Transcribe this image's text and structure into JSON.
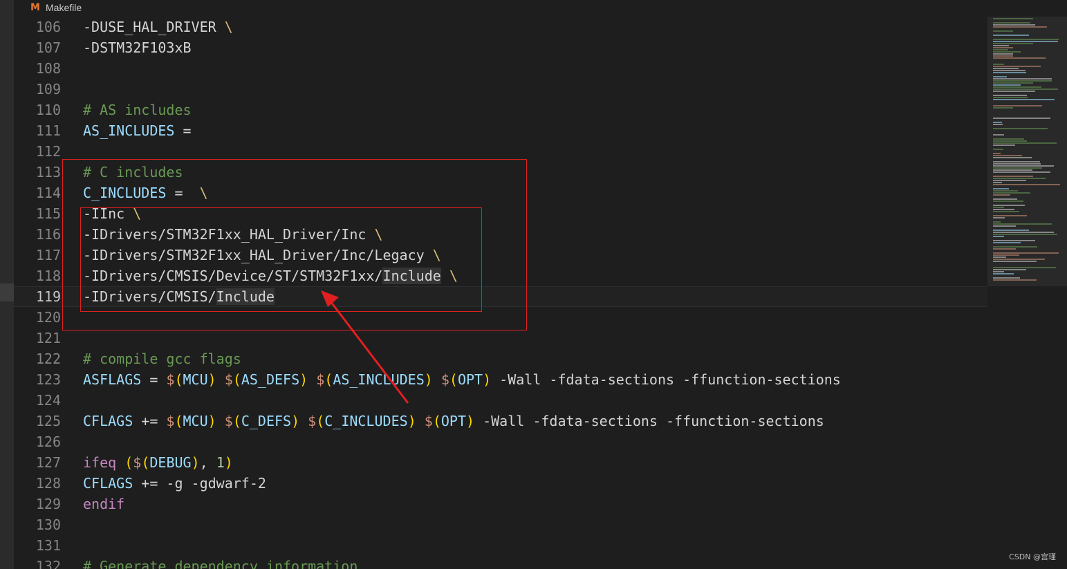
{
  "tab": {
    "label": "Makefile",
    "icon": "makefile-m-icon",
    "icon_glyph": "M"
  },
  "lines": [
    {
      "n": "106",
      "tokens": [
        [
          "plain",
          "-DUSE_HAL_DRIVER "
        ],
        [
          "punct",
          "\\"
        ]
      ]
    },
    {
      "n": "107",
      "tokens": [
        [
          "plain",
          "-DSTM32F103xB"
        ]
      ]
    },
    {
      "n": "108",
      "tokens": []
    },
    {
      "n": "109",
      "tokens": []
    },
    {
      "n": "110",
      "tokens": [
        [
          "comment",
          "# AS includes"
        ]
      ]
    },
    {
      "n": "111",
      "tokens": [
        [
          "var",
          "AS_INCLUDES"
        ],
        [
          "plain",
          " ="
        ]
      ]
    },
    {
      "n": "112",
      "tokens": []
    },
    {
      "n": "113",
      "tokens": [
        [
          "comment",
          "# C includes"
        ]
      ]
    },
    {
      "n": "114",
      "tokens": [
        [
          "var",
          "C_INCLUDES"
        ],
        [
          "plain",
          " =  "
        ],
        [
          "punct",
          "\\"
        ]
      ]
    },
    {
      "n": "115",
      "tokens": [
        [
          "plain",
          "-IInc "
        ],
        [
          "punct",
          "\\"
        ]
      ]
    },
    {
      "n": "116",
      "tokens": [
        [
          "plain",
          "-IDrivers/STM32F1xx_HAL_Driver/Inc "
        ],
        [
          "punct",
          "\\"
        ]
      ]
    },
    {
      "n": "117",
      "tokens": [
        [
          "plain",
          "-IDrivers/STM32F1xx_HAL_Driver/Inc/Legacy "
        ],
        [
          "punct",
          "\\"
        ]
      ]
    },
    {
      "n": "118",
      "tokens": [
        [
          "plain",
          "-IDrivers/CMSIS/Device/ST/STM32F1xx/"
        ],
        [
          "hl",
          "Include"
        ],
        [
          "plain",
          " "
        ],
        [
          "punct",
          "\\"
        ]
      ]
    },
    {
      "n": "119",
      "current": true,
      "tokens": [
        [
          "plain",
          "-IDrivers/CMSIS/"
        ],
        [
          "hl",
          "Include"
        ]
      ]
    },
    {
      "n": "120",
      "tokens": []
    },
    {
      "n": "121",
      "tokens": []
    },
    {
      "n": "122",
      "tokens": [
        [
          "comment",
          "# compile gcc flags"
        ]
      ]
    },
    {
      "n": "123",
      "tokens": [
        [
          "var",
          "ASFLAGS"
        ],
        [
          "plain",
          " = "
        ],
        [
          "dollar",
          "$"
        ],
        [
          "paren",
          "("
        ],
        [
          "var",
          "MCU"
        ],
        [
          "paren",
          ")"
        ],
        [
          "plain",
          " "
        ],
        [
          "dollar",
          "$"
        ],
        [
          "paren",
          "("
        ],
        [
          "var",
          "AS_DEFS"
        ],
        [
          "paren",
          ")"
        ],
        [
          "plain",
          " "
        ],
        [
          "dollar",
          "$"
        ],
        [
          "paren",
          "("
        ],
        [
          "var",
          "AS_INCLUDES"
        ],
        [
          "paren",
          ")"
        ],
        [
          "plain",
          " "
        ],
        [
          "dollar",
          "$"
        ],
        [
          "paren",
          "("
        ],
        [
          "var",
          "OPT"
        ],
        [
          "paren",
          ")"
        ],
        [
          "plain",
          " -Wall -fdata-sections -ffunction-sections"
        ]
      ]
    },
    {
      "n": "124",
      "tokens": []
    },
    {
      "n": "125",
      "tokens": [
        [
          "var",
          "CFLAGS"
        ],
        [
          "plain",
          " += "
        ],
        [
          "dollar",
          "$"
        ],
        [
          "paren",
          "("
        ],
        [
          "var",
          "MCU"
        ],
        [
          "paren",
          ")"
        ],
        [
          "plain",
          " "
        ],
        [
          "dollar",
          "$"
        ],
        [
          "paren",
          "("
        ],
        [
          "var",
          "C_DEFS"
        ],
        [
          "paren",
          ")"
        ],
        [
          "plain",
          " "
        ],
        [
          "dollar",
          "$"
        ],
        [
          "paren",
          "("
        ],
        [
          "var",
          "C_INCLUDES"
        ],
        [
          "paren",
          ")"
        ],
        [
          "plain",
          " "
        ],
        [
          "dollar",
          "$"
        ],
        [
          "paren",
          "("
        ],
        [
          "var",
          "OPT"
        ],
        [
          "paren",
          ")"
        ],
        [
          "plain",
          " -Wall -fdata-sections -ffunction-sections"
        ]
      ]
    },
    {
      "n": "126",
      "tokens": []
    },
    {
      "n": "127",
      "tokens": [
        [
          "kw",
          "ifeq"
        ],
        [
          "plain",
          " "
        ],
        [
          "paren",
          "("
        ],
        [
          "dollar",
          "$"
        ],
        [
          "paren",
          "("
        ],
        [
          "var",
          "DEBUG"
        ],
        [
          "paren",
          ")"
        ],
        [
          "plain",
          ", "
        ],
        [
          "num",
          "1"
        ],
        [
          "paren",
          ")"
        ]
      ]
    },
    {
      "n": "128",
      "tokens": [
        [
          "var",
          "CFLAGS"
        ],
        [
          "plain",
          " += -g -gdwarf-2"
        ]
      ]
    },
    {
      "n": "129",
      "tokens": [
        [
          "kw",
          "endif"
        ]
      ]
    },
    {
      "n": "130",
      "tokens": []
    },
    {
      "n": "131",
      "tokens": []
    },
    {
      "n": "132",
      "tokens": [
        [
          "comment",
          "# Generate dependency information"
        ]
      ]
    }
  ],
  "colors": {
    "comment": "#6a9955",
    "variable": "#9cdcfe",
    "keyword": "#c586c0",
    "annotation": "#e02020",
    "background": "#1e1e1e"
  },
  "watermark": "CSDN @宫瑾"
}
